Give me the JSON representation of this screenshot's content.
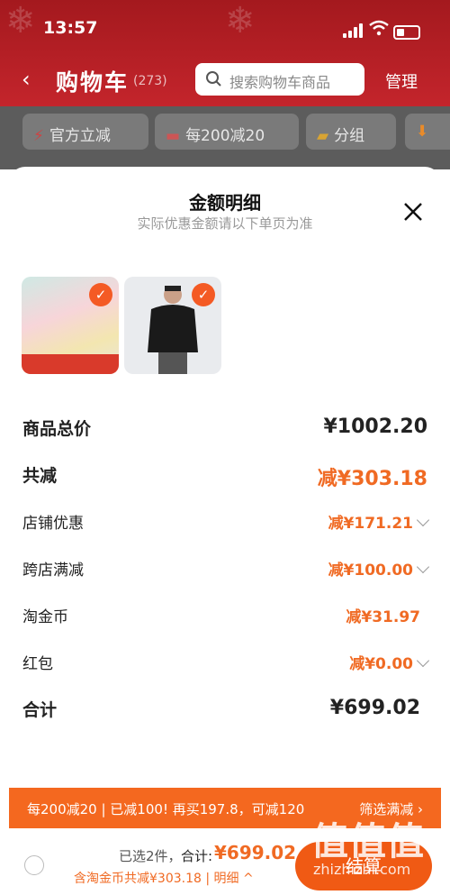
{
  "status_bar": {
    "time": "13:57"
  },
  "header": {
    "title": "购物车",
    "count": "(273)",
    "search_placeholder": "搜索购物车商品",
    "manage_label": "管理"
  },
  "chips": [
    {
      "label": "官方立减"
    },
    {
      "label": "每200减20"
    },
    {
      "label": "分组"
    }
  ],
  "sheet": {
    "title": "金额明细",
    "subtitle": "实际优惠金额请以下单页为准",
    "rows": [
      {
        "label": "商品总价",
        "value": "¥1002.20"
      },
      {
        "label": "共减",
        "value": "减¥303.18"
      },
      {
        "label": "店铺优惠",
        "value": "减¥171.21"
      },
      {
        "label": "跨店满减",
        "value": "减¥100.00"
      },
      {
        "label": "淘金币",
        "value": "减¥31.97"
      },
      {
        "label": "红包",
        "value": "减¥0.00"
      },
      {
        "label": "合计",
        "value": "¥699.02"
      }
    ]
  },
  "promo": {
    "text": "每200减20 | 已减100! 再买197.8，可减120",
    "button": "筛选满减 ›"
  },
  "footer": {
    "selected": "已选2件，",
    "total_label": "合计:",
    "total_value": "¥699.02",
    "saved": "含淘金币共减¥303.18 | 明细 ^",
    "checkout": "结算"
  },
  "watermark": {
    "site": "zhizhizhi.com"
  },
  "colors": {
    "accent": "#f06a23",
    "header": "#c4252c"
  }
}
